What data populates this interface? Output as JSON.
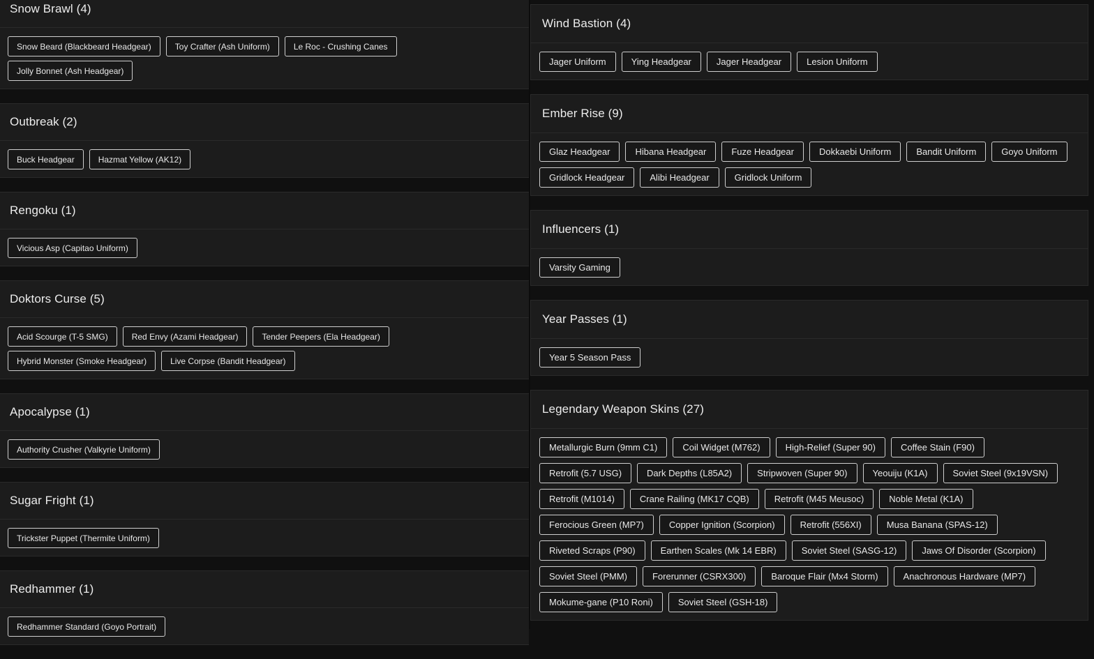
{
  "left_sections": [
    {
      "title": "Snow Brawl (4)",
      "items": [
        "Snow Beard (Blackbeard Headgear)",
        "Toy Crafter (Ash Uniform)",
        "Le Roc - Crushing Canes",
        "Jolly Bonnet (Ash Headgear)"
      ]
    },
    {
      "title": "Outbreak (2)",
      "items": [
        "Buck Headgear",
        "Hazmat Yellow (AK12)"
      ]
    },
    {
      "title": "Rengoku (1)",
      "items": [
        "Vicious Asp (Capitao Uniform)"
      ]
    },
    {
      "title": "Doktors Curse (5)",
      "items": [
        "Acid Scourge (T-5 SMG)",
        "Red Envy (Azami Headgear)",
        "Tender Peepers (Ela Headgear)",
        "Hybrid Monster (Smoke Headgear)",
        "Live Corpse (Bandit Headgear)"
      ]
    },
    {
      "title": "Apocalypse (1)",
      "items": [
        "Authority Crusher (Valkyrie Uniform)"
      ]
    },
    {
      "title": "Sugar Fright (1)",
      "items": [
        "Trickster Puppet (Thermite Uniform)"
      ]
    },
    {
      "title": "Redhammer (1)",
      "items": [
        "Redhammer Standard (Goyo Portrait)"
      ]
    }
  ],
  "right_sections": [
    {
      "title": "Wind Bastion (4)",
      "items": [
        "Jager Uniform",
        "Ying Headgear",
        "Jager Headgear",
        "Lesion Uniform"
      ]
    },
    {
      "title": "Ember Rise (9)",
      "items": [
        "Glaz Headgear",
        "Hibana Headgear",
        "Fuze Headgear",
        "Dokkaebi Uniform",
        "Bandit Uniform",
        "Goyo Uniform",
        "Gridlock Headgear",
        "Alibi Headgear",
        "Gridlock Uniform"
      ]
    },
    {
      "title": "Influencers (1)",
      "items": [
        "Varsity Gaming"
      ]
    },
    {
      "title": "Year Passes (1)",
      "items": [
        "Year 5 Season Pass"
      ]
    },
    {
      "title": "Legendary Weapon Skins (27)",
      "items": [
        "Metallurgic Burn (9mm C1)",
        "Coil Widget (M762)",
        "High-Relief (Super 90)",
        "Coffee Stain (F90)",
        "Retrofit (5.7 USG)",
        "Dark Depths (L85A2)",
        "Stripwoven (Super 90)",
        "Yeouiju (K1A)",
        "Soviet Steel (9x19VSN)",
        "Retrofit (M1014)",
        "Crane Railing (MK17 CQB)",
        "Retrofit (M45 Meusoc)",
        "Noble Metal (K1A)",
        "Ferocious Green (MP7)",
        "Copper Ignition (Scorpion)",
        "Retrofit (556XI)",
        "Musa Banana (SPAS-12)",
        "Riveted Scraps (P90)",
        "Earthen Scales (Mk 14 EBR)",
        "Soviet Steel (SASG-12)",
        "Jaws Of Disorder (Scorpion)",
        "Soviet Steel (PMM)",
        "Forerunner (CSRX300)",
        "Baroque Flair (Mx4 Storm)",
        "Anachronous Hardware (MP7)",
        "Mokume-gane (P10 Roni)",
        "Soviet Steel (GSH-18)"
      ]
    }
  ]
}
